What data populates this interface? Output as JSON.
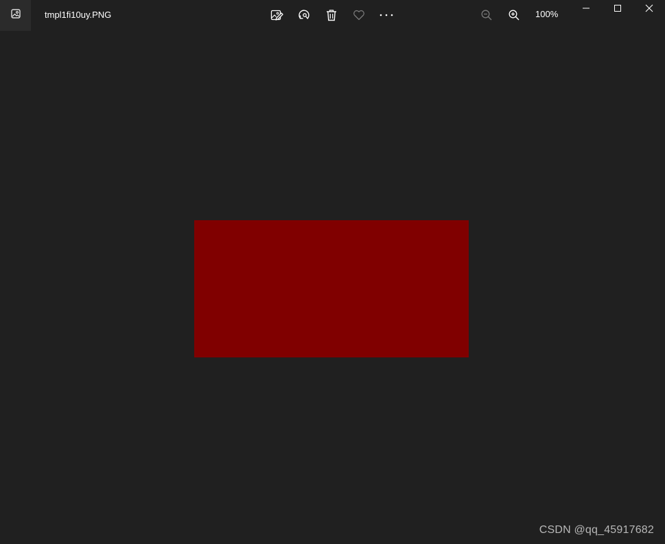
{
  "window": {
    "file_name": "tmpl1fi10uy.PNG",
    "zoom_level": "100%"
  },
  "toolbar": {
    "items": [
      "edit-image-icon",
      "rotate-icon",
      "delete-icon",
      "favorite-heart-icon",
      "more-options-icon"
    ],
    "zoom_out_icon": "zoom-out-icon",
    "zoom_in_icon": "zoom-in-icon"
  },
  "window_controls": [
    "minimize-icon",
    "maximize-icon",
    "close-icon"
  ],
  "image": {
    "fill_color": "#800000"
  },
  "watermark": {
    "text": "CSDN @qq_45917682"
  },
  "colors": {
    "background": "#202020",
    "titlebar_icon_bg": "#2b2b2b",
    "disabled_icon": "#7a7a7a",
    "text": "#ffffff"
  }
}
